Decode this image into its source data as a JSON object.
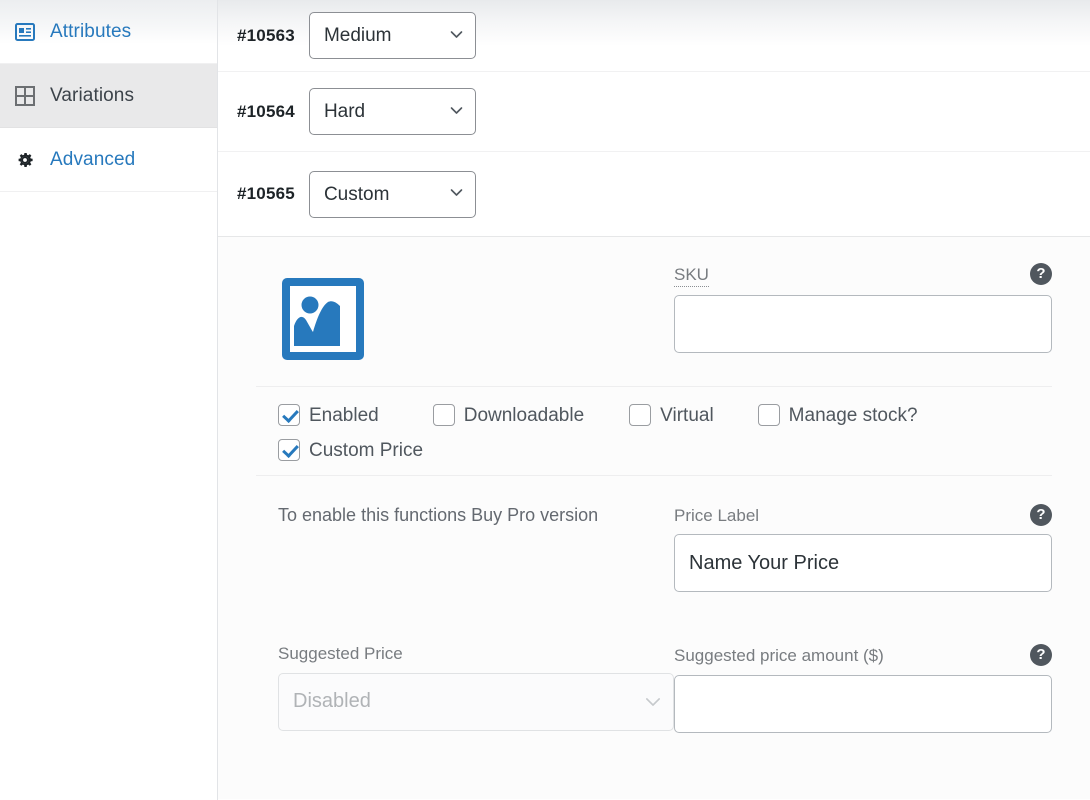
{
  "sidebar": {
    "items": [
      {
        "label": "Attributes",
        "icon": "attributes-icon",
        "active": false
      },
      {
        "label": "Variations",
        "icon": "grid-icon",
        "active": true
      },
      {
        "label": "Advanced",
        "icon": "gear-icon",
        "active": false
      }
    ]
  },
  "variation_rows": [
    {
      "id": "#10563",
      "selected": "Medium"
    },
    {
      "id": "#10564",
      "selected": "Hard"
    },
    {
      "id": "#10565",
      "selected": "Custom"
    }
  ],
  "detail": {
    "thumbnail_icon": "image-placeholder-icon",
    "sku": {
      "label": "SKU",
      "value": "",
      "placeholder": "",
      "help": "?"
    },
    "checkboxes": [
      {
        "label": "Enabled",
        "checked": true
      },
      {
        "label": "Downloadable",
        "checked": false
      },
      {
        "label": "Virtual",
        "checked": false
      },
      {
        "label": "Manage stock?",
        "checked": false
      },
      {
        "label": "Custom Price",
        "checked": true
      }
    ],
    "pro_notice": "To enable this functions Buy Pro version",
    "price_label": {
      "label": "Price Label",
      "value": "Name Your Price",
      "placeholder": "",
      "help": "?"
    },
    "suggested_price": {
      "label": "Suggested Price",
      "selected": "Disabled"
    },
    "suggested_price_amount": {
      "label": "Suggested price amount ($)",
      "value": "",
      "placeholder": "",
      "help": "?"
    }
  },
  "colors": {
    "link": "#2779bd",
    "accent": "#2779bd",
    "text": "#3c434a",
    "muted": "#787c80",
    "help_bg": "#50575e",
    "panel_bg": "#fcfcfc",
    "active_item_bg": "#e9e9ea"
  }
}
